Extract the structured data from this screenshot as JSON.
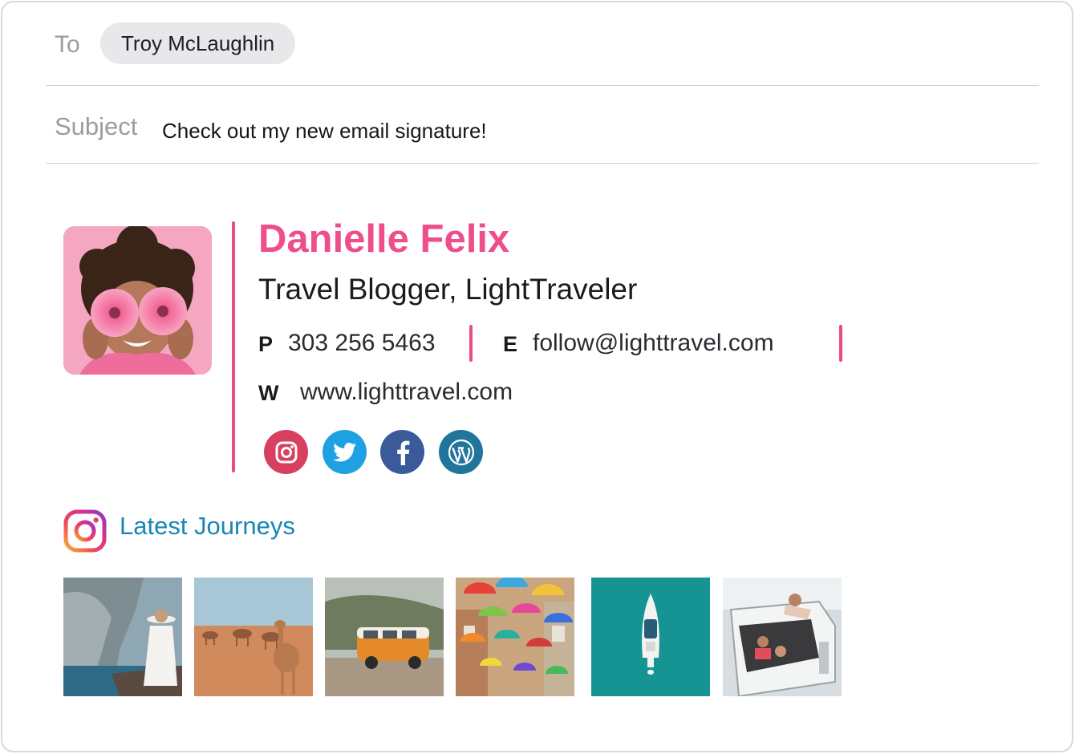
{
  "header": {
    "to_label": "To",
    "recipient": "Troy McLaughlin",
    "subject_label": "Subject",
    "subject": "Check out my new email signature!"
  },
  "signature": {
    "name": "Danielle Felix",
    "title": "Travel Blogger, LightTraveler",
    "phone_label": "P",
    "phone": "303 256 5463",
    "email_label": "E",
    "email": "follow@lighttravel.com",
    "website_label": "W",
    "website": "www.lighttravel.com",
    "accent_color": "#ee4e8b",
    "social": [
      {
        "icon": "instagram-icon",
        "color": "#d8405f"
      },
      {
        "icon": "twitter-icon",
        "color": "#1da1e3"
      },
      {
        "icon": "facebook-icon",
        "color": "#3b5a9a"
      },
      {
        "icon": "wordpress-icon",
        "color": "#21759b"
      }
    ]
  },
  "gallery": {
    "title": "Latest Journeys",
    "title_color": "#1985b5",
    "photos": [
      {
        "subject": "woman-on-cliff-photo"
      },
      {
        "subject": "camels-desert-photo"
      },
      {
        "subject": "orange-van-photo"
      },
      {
        "subject": "umbrellas-street-photo"
      },
      {
        "subject": "boat-aerial-photo"
      },
      {
        "subject": "friends-van-photo"
      }
    ]
  }
}
